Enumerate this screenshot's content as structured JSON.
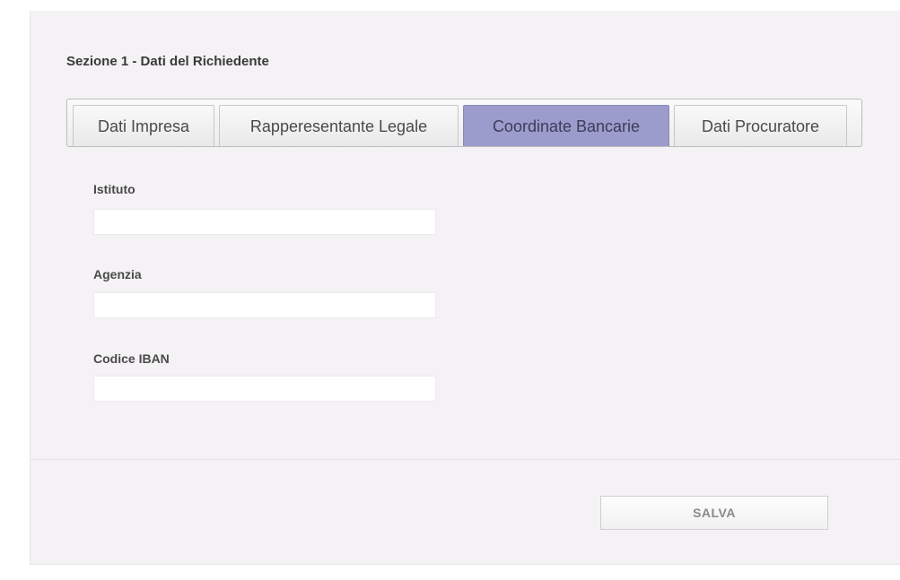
{
  "section": {
    "title": "Sezione 1 - Dati del Richiedente"
  },
  "tabs": [
    {
      "label": "Dati Impresa",
      "active": false
    },
    {
      "label": "Rapperesentante Legale",
      "active": false
    },
    {
      "label": "Coordinate Bancarie",
      "active": true
    },
    {
      "label": "Dati Procuratore",
      "active": false
    }
  ],
  "form": {
    "fields": [
      {
        "label": "Istituto",
        "value": "",
        "placeholder": ""
      },
      {
        "label": "Agenzia",
        "value": "",
        "placeholder": ""
      },
      {
        "label": "Codice IBAN",
        "value": "",
        "placeholder": ""
      }
    ],
    "save_label": "SALVA"
  },
  "colors": {
    "active_tab": "#9b9bcc",
    "panel_background": "#f4f2f4"
  }
}
